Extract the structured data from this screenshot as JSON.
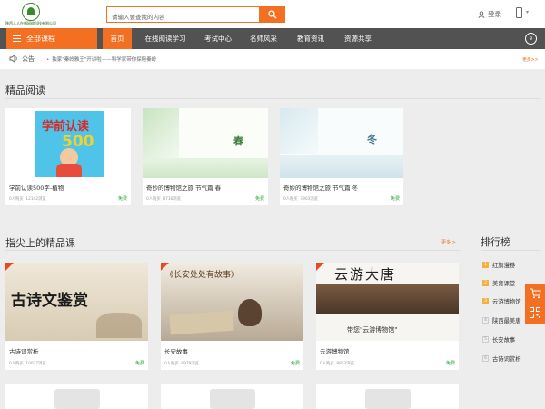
{
  "header": {
    "logo_org": "陕西人人在线网络科技有限公司",
    "search_placeholder": "请输入要查找的内容",
    "login_label": "登录"
  },
  "nav": {
    "all_courses": "全部课程",
    "items": [
      "首页",
      "在线阅读学习",
      "考试中心",
      "名师风采",
      "教育资讯",
      "资源共享"
    ],
    "active_index": 0
  },
  "notice": {
    "label": "公告",
    "text": "独家\"秦岭雅王\"开讲啦——科学家带你探秘秦岭",
    "more": "更多>>"
  },
  "reading": {
    "title": "精品阅读",
    "cards": [
      {
        "name": "学前认读500字-植物",
        "buyers": "0人购买",
        "views": "12142浏览",
        "price": "免费",
        "cover_text": "学前认读",
        "cover_sub": "500"
      },
      {
        "name": "奇妙的博物馆之旅 节气篇 春",
        "buyers": "0人购买",
        "views": "8716浏览",
        "price": "免费",
        "cover_text": "春"
      },
      {
        "name": "奇妙的博物馆之旅 节气篇 冬",
        "buyers": "0人购买",
        "views": "7903浏览",
        "price": "免费",
        "cover_text": "冬"
      }
    ]
  },
  "courses": {
    "title": "指尖上的精品课",
    "more": "更多 >",
    "cards": [
      {
        "name": "古诗词赏析",
        "buyers": "0人购买",
        "views": "10027浏览",
        "price": "免费",
        "cover_text": "古诗文鉴赏"
      },
      {
        "name": "长安故事",
        "buyers": "0人购买",
        "views": "9979浏览",
        "price": "免费",
        "cover_text": "《长安处处有故事》"
      },
      {
        "name": "云游博物馆",
        "buyers": "0人购买",
        "views": "8863浏览",
        "price": "免费",
        "cover_text": "云游大唐",
        "cover_caption": "带您\"云游博物馆\""
      }
    ]
  },
  "ranking": {
    "title": "排行榜",
    "items": [
      {
        "num": "1",
        "label": "红旗漫卷"
      },
      {
        "num": "2",
        "label": "美育课堂"
      },
      {
        "num": "3",
        "label": "云游博物馆"
      },
      {
        "num": "4",
        "label": "陕西最美唐"
      },
      {
        "num": "5",
        "label": "长安故事"
      },
      {
        "num": "6",
        "label": "古诗词赏析"
      }
    ]
  },
  "colors": {
    "accent": "#f36f21",
    "nav_bg": "#525252",
    "free": "#22a33a"
  }
}
